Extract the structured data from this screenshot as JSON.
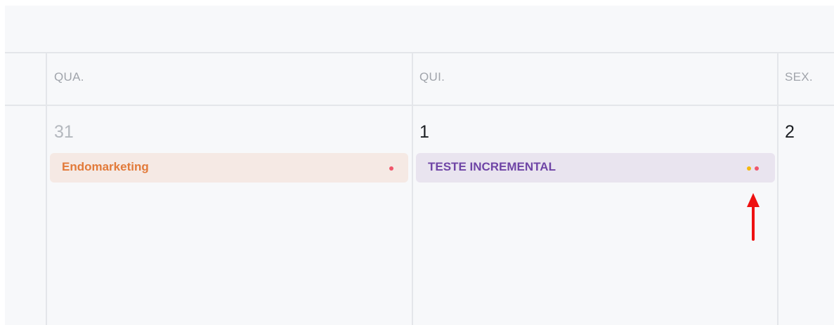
{
  "days": [
    {
      "header": "QUA.",
      "number": "31",
      "muted": true
    },
    {
      "header": "QUI.",
      "number": "1",
      "muted": false
    },
    {
      "header": "SEX.",
      "number": "2",
      "muted": false
    }
  ],
  "events": [
    {
      "label": "Endomarketing",
      "background": "#f5e9e4",
      "text_color": "#e27a3a",
      "dots": [
        "#f0566b"
      ]
    },
    {
      "label": "TESTE INCREMENTAL",
      "background": "#e9e4ef",
      "text_color": "#6f45a6",
      "dots": [
        "#f5b80f",
        "#f0566b"
      ]
    }
  ],
  "annotation": {
    "arrow_color": "#ee1111",
    "direction": "up"
  }
}
